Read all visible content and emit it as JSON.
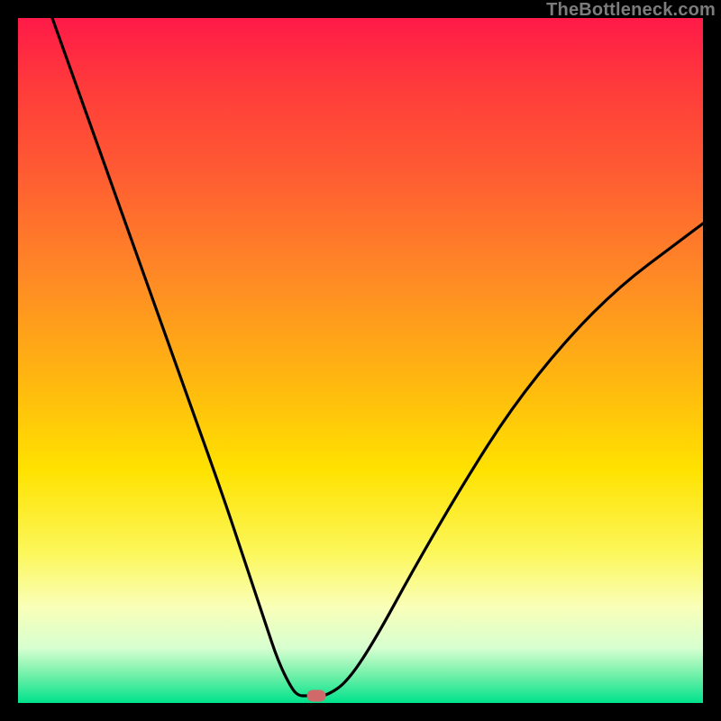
{
  "watermark": "TheBottleneck.com",
  "marker_color": "#d06a6a",
  "chart_data": {
    "type": "line",
    "title": "",
    "xlabel": "",
    "ylabel": "",
    "xlim": [
      0,
      100
    ],
    "ylim": [
      0,
      100
    ],
    "series": [
      {
        "name": "bottleneck-curve",
        "x": [
          5,
          10,
          15,
          20,
          25,
          30,
          33,
          36,
          38,
          40,
          41,
          42,
          43.5,
          45,
          48,
          52,
          58,
          65,
          72,
          80,
          88,
          96,
          100
        ],
        "y": [
          100,
          86,
          72,
          58,
          44,
          30,
          21,
          12,
          6,
          2,
          0.8,
          0.2,
          0,
          0.4,
          3,
          9,
          20,
          32,
          43,
          53,
          61,
          67,
          70
        ]
      }
    ],
    "markers": [
      {
        "name": "optimal-point",
        "x": 43.5,
        "y": 0
      }
    ],
    "background_gradient": {
      "top": "#ff1a48",
      "middle": "#ffe200",
      "bottom": "#00e28c"
    }
  }
}
